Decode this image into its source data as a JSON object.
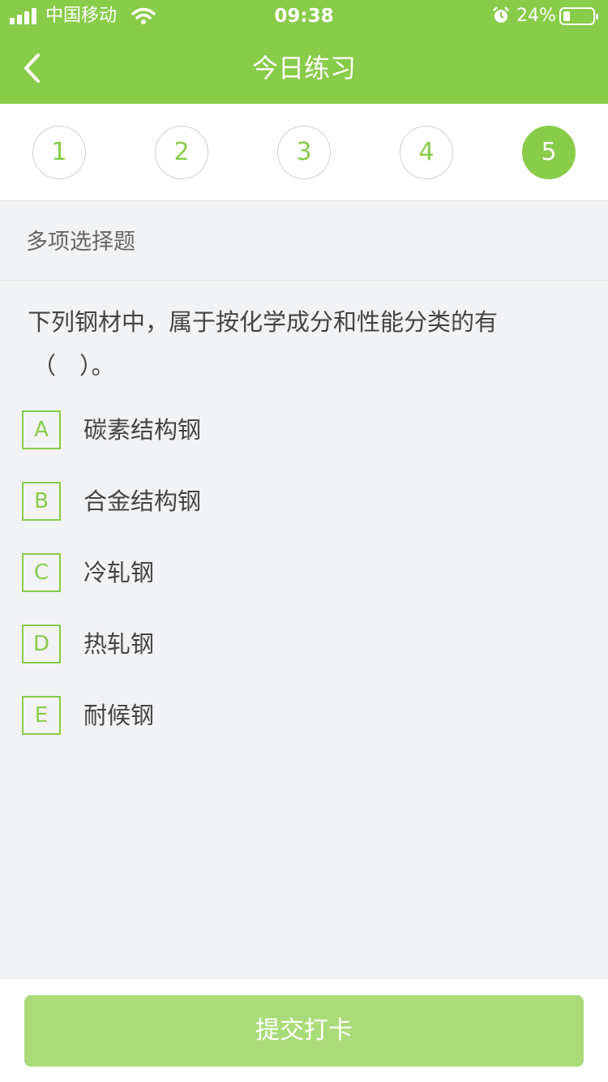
{
  "status_bar": {
    "carrier": "中国移动",
    "time": "09:38",
    "battery_percent": "24%",
    "battery_level": 0.24,
    "icons": [
      "signal-icon",
      "wifi-icon",
      "alarm-icon",
      "battery-icon"
    ]
  },
  "nav": {
    "title": "今日练习",
    "back_icon": "chevron-left-icon"
  },
  "question_numbers": [
    "1",
    "2",
    "3",
    "4",
    "5"
  ],
  "active_question": "5",
  "question": {
    "type": "多项选择题",
    "text_line1": "下列钢材中，属于按化学成分和性能分类的有",
    "text_line2": "（　）。",
    "options": [
      {
        "letter": "A",
        "text": "碳素结构钢"
      },
      {
        "letter": "B",
        "text": "合金结构钢"
      },
      {
        "letter": "C",
        "text": "冷轧钢"
      },
      {
        "letter": "D",
        "text": "热轧钢"
      },
      {
        "letter": "E",
        "text": "耐候钢"
      }
    ]
  },
  "footer": {
    "submit_label": "提交打卡"
  },
  "colors": {
    "accent": "#88cc4a",
    "submit_bg": "#a9dc78",
    "page_bg": "#f2f3f5"
  }
}
